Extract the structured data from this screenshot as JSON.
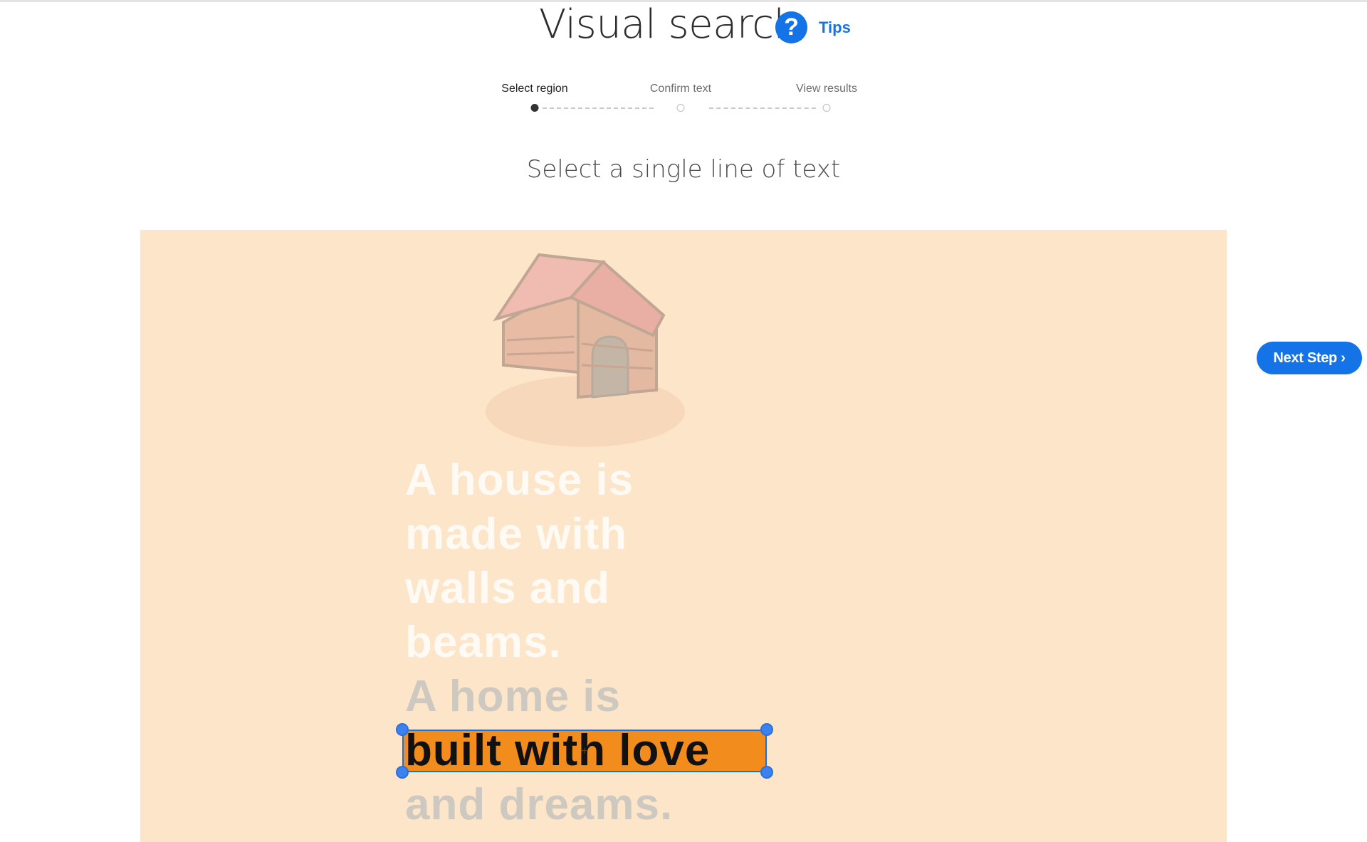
{
  "header": {
    "title": "Visual search",
    "help_icon": "?",
    "tips_label": "Tips"
  },
  "stepper": {
    "steps": [
      {
        "label": "Select region",
        "state": "active"
      },
      {
        "label": "Confirm text",
        "state": "pending"
      },
      {
        "label": "View results",
        "state": "pending"
      }
    ]
  },
  "instruction": "Select a single line of text",
  "image": {
    "illustration": "doghouse-icon",
    "background_color": "#fce5c9",
    "lines": [
      "A house is",
      "made with",
      "walls and",
      "beams.",
      "A home is",
      "built with love",
      "and dreams."
    ],
    "selected_line": "built with love",
    "selection_color": "#f28c1c"
  },
  "next_button": {
    "label": "Next Step ›"
  },
  "colors": {
    "accent": "#1473e6",
    "text_dark": "#2c2c2c"
  }
}
